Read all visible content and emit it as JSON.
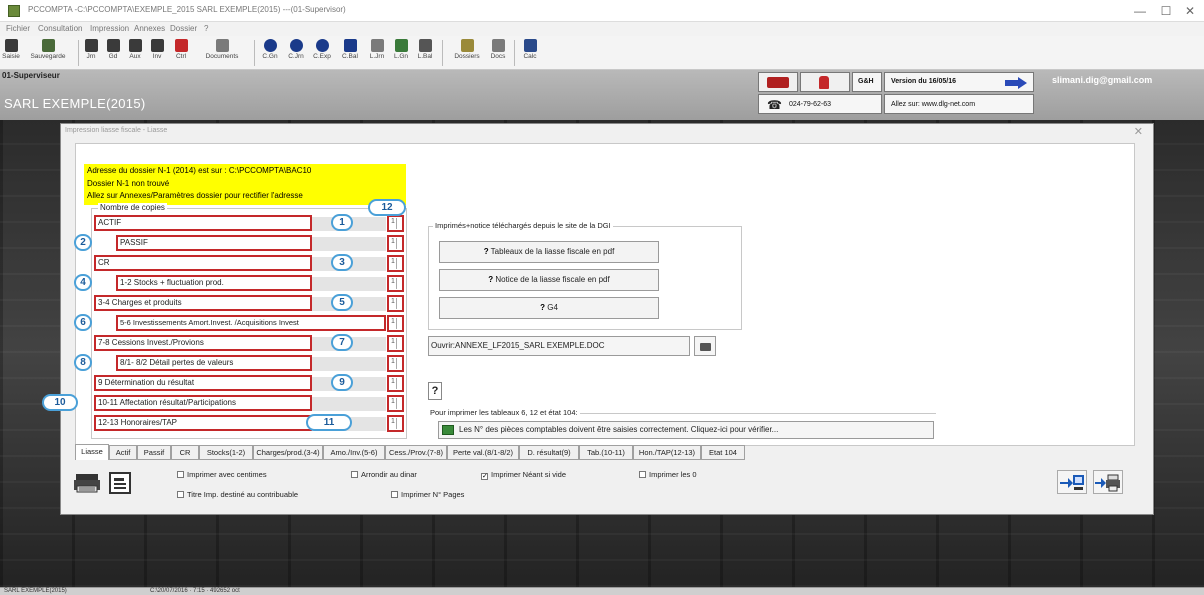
{
  "window": {
    "title": "PCCOMPTA -C:\\PCCOMPTA\\EXEMPLE_2015 SARL EXEMPLE(2015) ---(01-Supervisor)",
    "controls": {
      "minimize": "—",
      "maximize": "☐",
      "close": "✕"
    }
  },
  "menu": [
    "Fichier",
    "Consultation",
    "Impression",
    "Annexes",
    "Dossier",
    "?"
  ],
  "toolbar": [
    {
      "label": "Saisie",
      "icon": "edit-icon",
      "color": "#3a3a3a"
    },
    {
      "label": "Sauvegarde",
      "icon": "save-icon",
      "color": "#4a6a3a"
    },
    {
      "label": "Jrn",
      "icon": "journal-icon",
      "color": "#3a3a3a"
    },
    {
      "label": "Gd",
      "icon": "ledger-icon",
      "color": "#3a3a3a"
    },
    {
      "label": "Aux",
      "icon": "auxiliary-icon",
      "color": "#3a3a3a"
    },
    {
      "label": "Inv",
      "icon": "inventory-icon",
      "color": "#3a3a3a"
    },
    {
      "label": "Ctrl",
      "icon": "check-icon",
      "color": "#c4282a"
    },
    {
      "label": "Documents",
      "icon": "documents-icon",
      "color": "#7a7a7a"
    },
    {
      "label": "C.Gn",
      "icon": "globe-icon",
      "color": "#1a3a8a"
    },
    {
      "label": "C.Jrn",
      "icon": "globe-icon",
      "color": "#1a3a8a"
    },
    {
      "label": "C.Exp",
      "icon": "globe-icon",
      "color": "#1a3a8a"
    },
    {
      "label": "C.Bal",
      "icon": "balance-icon",
      "color": "#1a3a8a"
    },
    {
      "label": "L.Jrn",
      "icon": "arrows-icon",
      "color": "#7a7a7a"
    },
    {
      "label": "L.Gn",
      "icon": "tree-icon",
      "color": "#3a7a3a"
    },
    {
      "label": "L.Bal",
      "icon": "scale-icon",
      "color": "#555555"
    },
    {
      "label": "Dossiers",
      "icon": "folder-icon",
      "color": "#9a8a3a"
    },
    {
      "label": "Docs",
      "icon": "folder-arrow-icon",
      "color": "#7a7a7a"
    },
    {
      "label": "Calc",
      "icon": "calculator-icon",
      "color": "#2a4a8a"
    }
  ],
  "infobar": {
    "user": "01-Superviseur",
    "company": "SARL EXEMPLE(2015)",
    "badge": "G&H",
    "version": "Version du 16/05/16",
    "phone": "024-79-62-63",
    "site": "Allez sur: www.dlg-net.com",
    "email": "slimani.dig@gmail.com"
  },
  "dialog": {
    "title": "Impression liasse fiscale - Liasse",
    "close": "✕",
    "note": [
      "Adresse du dossier N-1 (2014) est sur : C:\\PCCOMPTA\\BAC10",
      "Dossier N-1 non trouvé",
      "Allez sur Annexes/Paramètres dossier pour rectifier l'adresse"
    ],
    "copies_label": "Nombre de copies",
    "rows": [
      {
        "label": "ACTIF",
        "value": "1"
      },
      {
        "label": "PASSIF",
        "value": "1"
      },
      {
        "label": "CR",
        "value": "1"
      },
      {
        "label": "1-2 Stocks + fluctuation prod.",
        "value": "1"
      },
      {
        "label": "3-4 Charges et produits",
        "value": "1"
      },
      {
        "label": "5-6 Investissements Amort.Invest. /Acquisitions Invest",
        "value": "1"
      },
      {
        "label": "7-8 Cessions Invest./Provions",
        "value": "1"
      },
      {
        "label": "8/1- 8/2 Détail pertes de valeurs",
        "value": "1"
      },
      {
        "label": "9 Détermination du résultat",
        "value": "1"
      },
      {
        "label": "10-11 Affectation résultat/Participations",
        "value": "1"
      },
      {
        "label": "12-13 Honoraires/TAP",
        "value": "1"
      }
    ],
    "markers": [
      "1",
      "2",
      "3",
      "4",
      "5",
      "6",
      "7",
      "8",
      "9",
      "10",
      "11",
      "12"
    ],
    "dgi_label": "Imprimés+notice téléchargés depuis le site de la DGI",
    "dgi_buttons": [
      "Tableaux de la liasse fiscale en pdf",
      "Notice de la liasse fiscale en pdf",
      "G4"
    ],
    "q_mark": "?",
    "open_doc": "Ouvrir:ANNEXE_LF2015_SARL EXEMPLE.DOC",
    "print_label": "Pour imprimer les tableaux 6, 12 et état 104:",
    "verify": "Les N° des pièces comptables doivent être saisies correctement. Cliquez-ici pour vérifier...",
    "tabs": [
      "Liasse",
      "Actif",
      "Passif",
      "CR",
      "Stocks(1-2)",
      "Charges/prod.(3-4)",
      "Amo./Inv.(5-6)",
      "Cess./Prov.(7-8)",
      "Perte val.(8/1-8/2)",
      "D. résultat(9)",
      "Tab.(10-11)",
      "Hon./TAP(12-13)",
      "Etat 104"
    ],
    "options": [
      {
        "label": "Imprimer avec centimes",
        "checked": false
      },
      {
        "label": "Arrondir au dinar",
        "checked": false
      },
      {
        "label": "Imprimer Néant si vide",
        "checked": true
      },
      {
        "label": "Imprimer les 0",
        "checked": false
      },
      {
        "label": "Titre Imp. destiné au contribuable",
        "checked": false
      },
      {
        "label": "Imprimer N° Pages",
        "checked": false
      }
    ],
    "check_mark": "✓"
  },
  "status": {
    "company": "SARL EXEMPLE(2015)",
    "info": "C:\\20/07/2016 · 7:15 · 492652 oct"
  },
  "colors": {
    "accent_red": "#c4282a",
    "marker_blue": "#4aa0d8",
    "note_yellow": "#ffff00"
  }
}
